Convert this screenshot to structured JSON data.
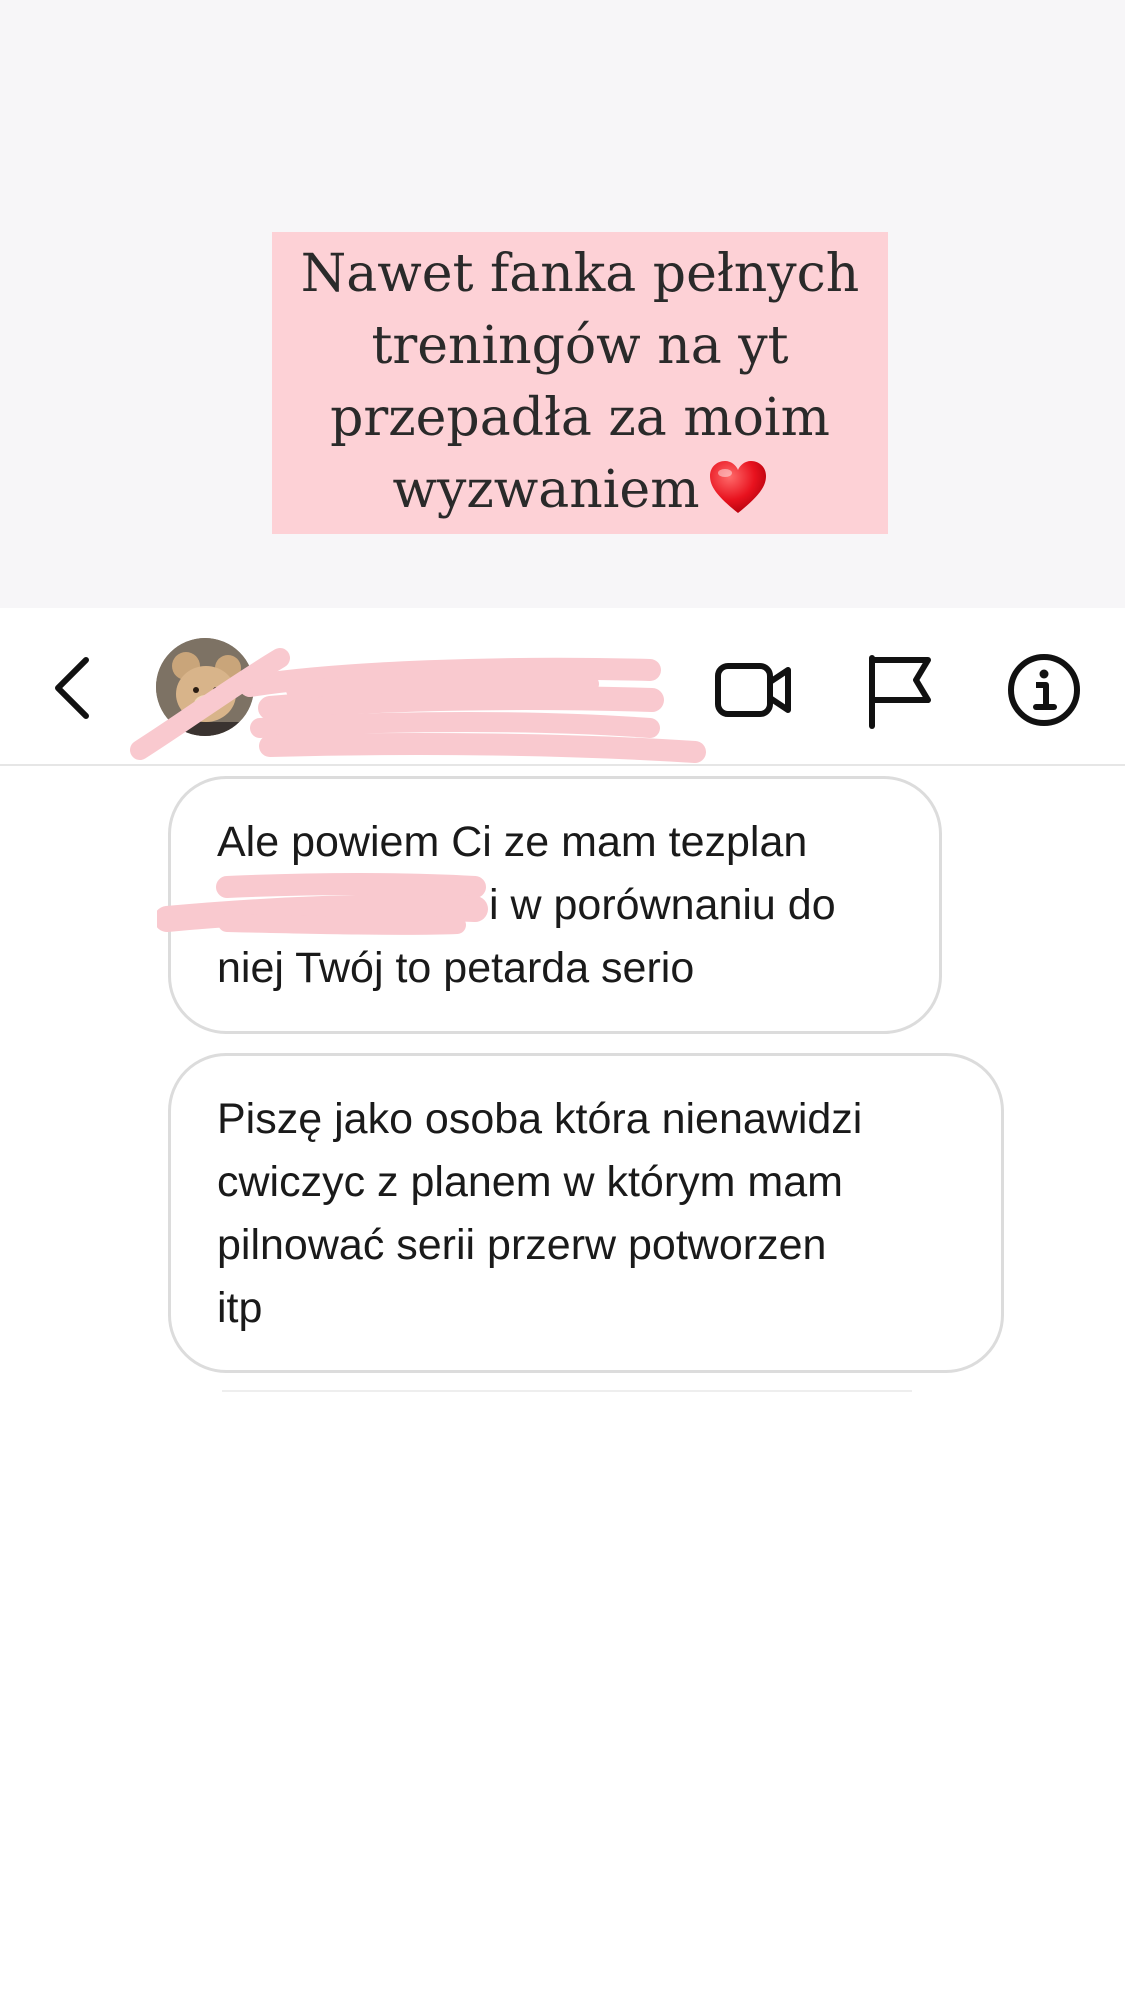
{
  "caption": {
    "lines": [
      "Nawet fanka pełnych",
      "treningów na yt",
      "przepadła za moim",
      "wyzwaniem"
    ],
    "emoji": "heart-emoji",
    "background": "#fdd1d6"
  },
  "header": {
    "back_icon": "chevron-left-icon",
    "avatar": "teddy-bear-avatar",
    "name": "",
    "subtitle": "",
    "redaction_color": "#f9c9cf",
    "actions": [
      {
        "icon": "video-camera-icon"
      },
      {
        "icon": "flag-icon"
      },
      {
        "icon": "info-icon"
      }
    ]
  },
  "messages": [
    {
      "line_1": "Ale powiem Ci ze mam tezplan",
      "line_2": "i w porównaniu do",
      "line_3": "niej Twój to petarda serio"
    },
    {
      "line_1": "Piszę jako osoba która nienawidzi",
      "line_2": "cwiczyc z planem w którym mam",
      "line_3": "pilnować serii przerw potworzen",
      "line_4": "itp"
    }
  ]
}
